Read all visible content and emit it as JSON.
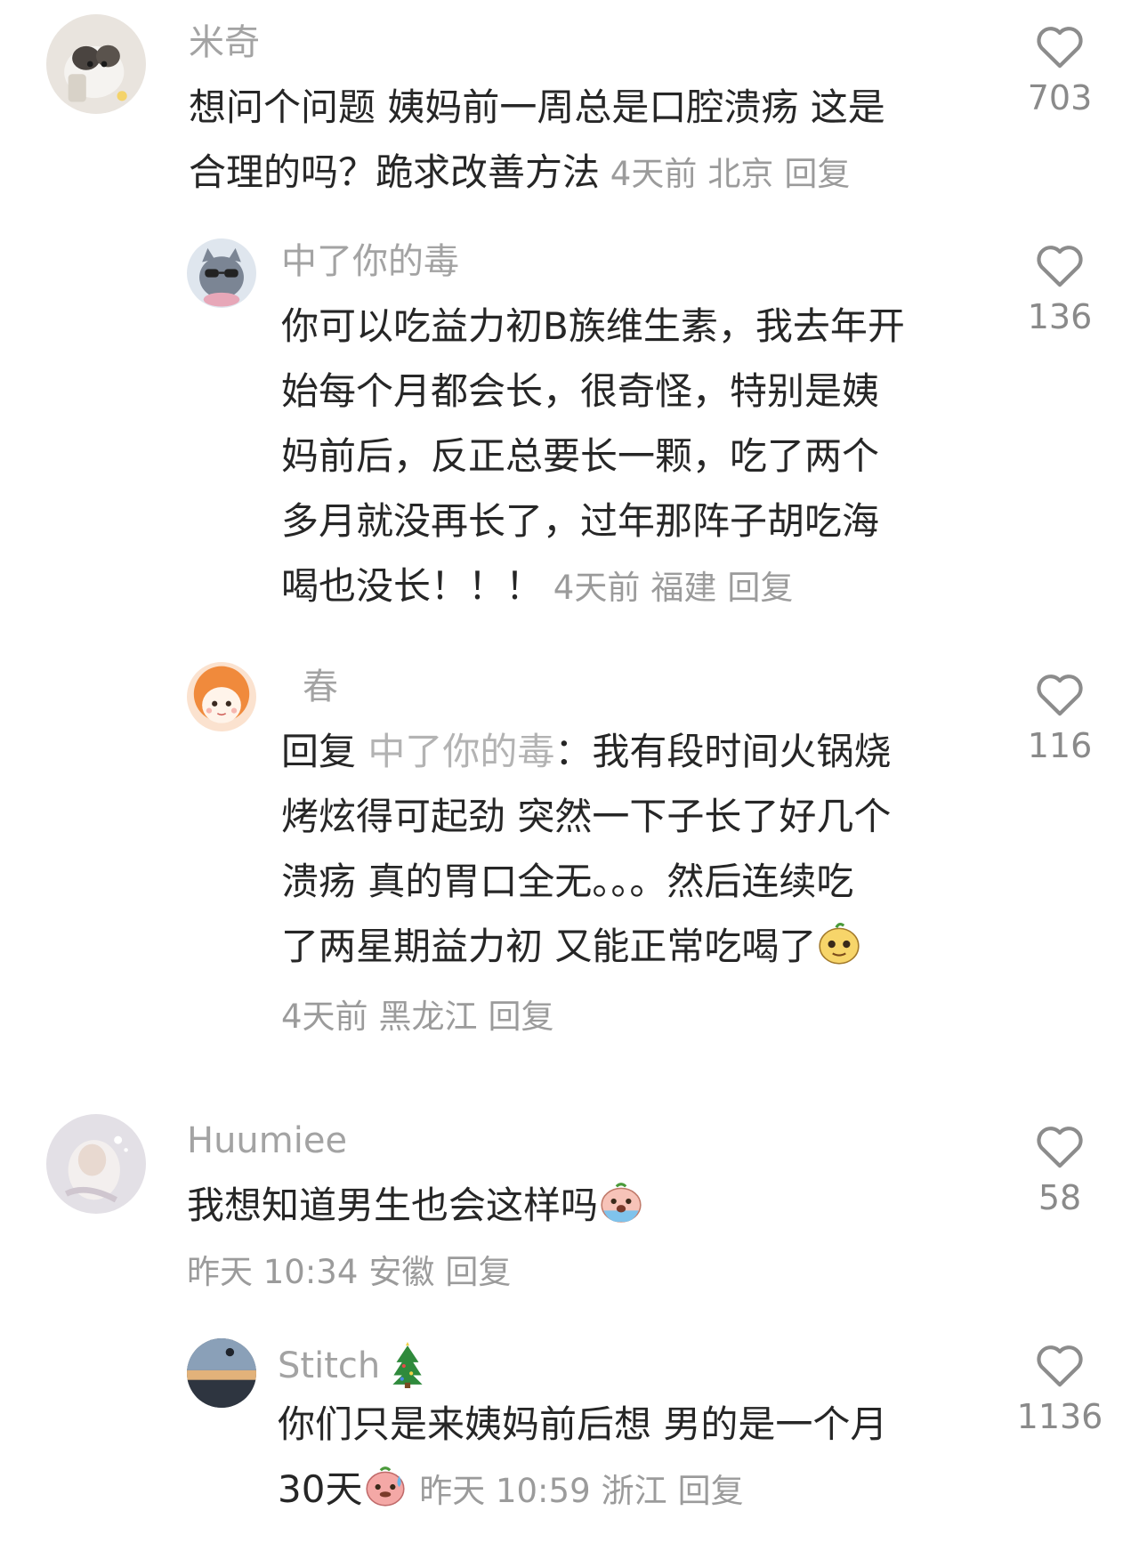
{
  "comments": [
    {
      "user": "米奇",
      "lines": [
        "想问个问题 姨妈前一周总是口腔溃疡 这是",
        "合理的吗？跪求改善方法"
      ],
      "time": "4天前",
      "location": "北京",
      "reply_label": "回复",
      "likes": "703"
    },
    {
      "user": "中了你的毒",
      "lines": [
        "你可以吃益力初B族维生素，我去年开",
        "始每个月都会长，很奇怪，特别是姨",
        "妈前后，反正总要长一颗，吃了两个",
        "多月就没再长了，过年那阵子胡吃海",
        "喝也没长！！！"
      ],
      "time": "4天前",
      "location": "福建",
      "reply_label": "回复",
      "likes": "136"
    },
    {
      "user": "春",
      "reply_prefix": "回复",
      "reply_to": "中了你的毒",
      "lines": [
        "：我有段时间火锅烧",
        "烤炫得可起劲 突然一下子长了好几个",
        "溃疡 真的胃口全无。。。然后连续吃",
        "了两星期益力初 又能正常吃喝了"
      ],
      "time": "4天前",
      "location": "黑龙江",
      "reply_label": "回复",
      "likes": "116"
    },
    {
      "user": "Huumiee",
      "lines": [
        "我想知道男生也会这样吗"
      ],
      "time": "昨天 10:34",
      "location": "安徽",
      "reply_label": "回复",
      "likes": "58"
    },
    {
      "user": "Stitch",
      "lines": [
        "你们只是来姨妈前后想 男的是一个月",
        "30天"
      ],
      "time": "昨天 10:59",
      "location": "浙江",
      "reply_label": "回复",
      "likes": "1136"
    }
  ],
  "colors": {
    "username": "#a3a3a3",
    "body": "#262626",
    "meta": "#9b9b9b",
    "heart": "#8c8c8c"
  }
}
